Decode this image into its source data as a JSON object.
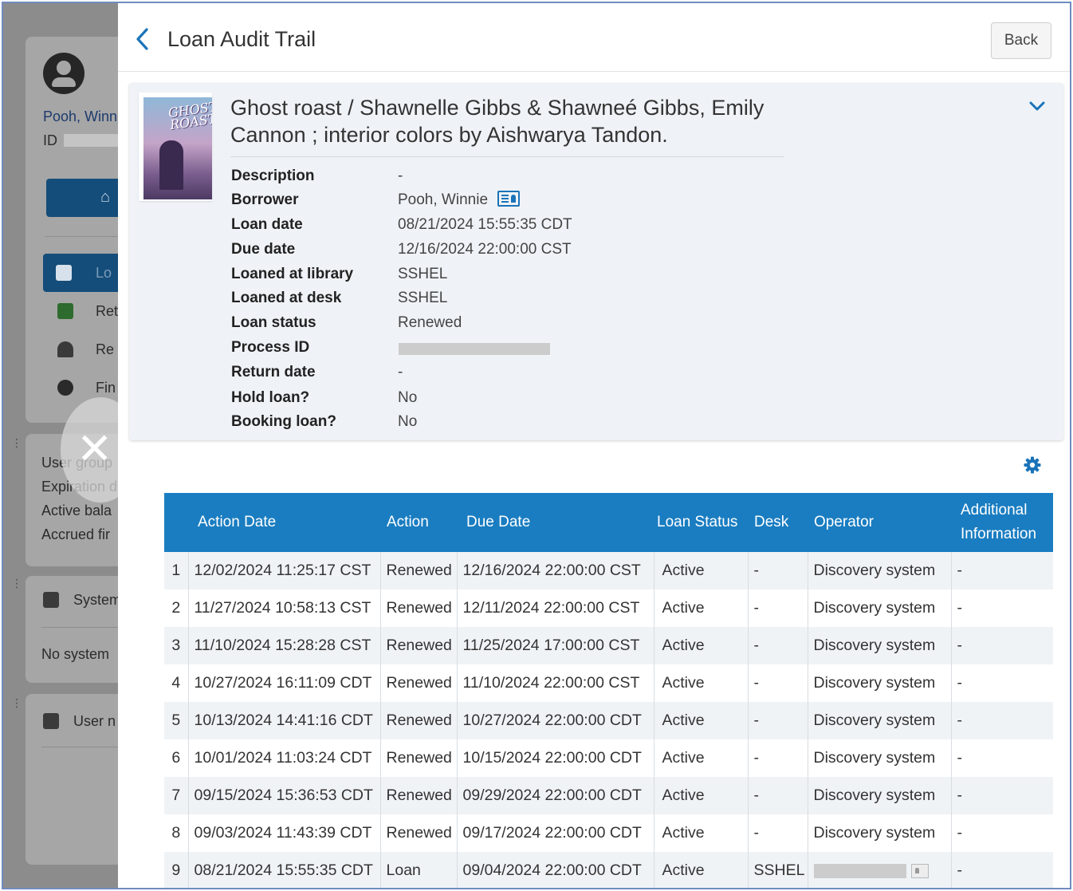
{
  "background": {
    "user_name": "Pooh, Winn",
    "id_label": "ID",
    "nav_items": [
      "Lo",
      "Ret",
      "Re",
      "Fin"
    ],
    "fines_label": "Fin",
    "info_lines": [
      "User group",
      "Expiration d",
      "Active bala",
      "Accrued fir"
    ],
    "system_section": "System",
    "system_empty": "No system",
    "user_notes_section": "User n"
  },
  "header": {
    "title": "Loan Audit Trail",
    "back_label": "Back"
  },
  "item": {
    "title": "Ghost roast / Shawnelle Gibbs & Shawneé Gibbs, Emily Cannon ; interior colors by Aishwarya Tandon.",
    "cover_text": "GHOST\nROAST",
    "fields": [
      {
        "label": "Description",
        "value": "-"
      },
      {
        "label": "Borrower",
        "value": "Pooh, Winnie"
      },
      {
        "label": "Loan date",
        "value": "08/21/2024 15:55:35 CDT"
      },
      {
        "label": "Due date",
        "value": "12/16/2024 22:00:00 CST"
      },
      {
        "label": "Loaned at library",
        "value": "SSHEL"
      },
      {
        "label": "Loaned at desk",
        "value": "SSHEL"
      },
      {
        "label": "Loan status",
        "value": "Renewed"
      },
      {
        "label": "Process ID",
        "value": ""
      },
      {
        "label": "Return date",
        "value": "-"
      },
      {
        "label": "Hold loan?",
        "value": "No"
      },
      {
        "label": "Booking loan?",
        "value": "No"
      }
    ]
  },
  "table": {
    "columns": [
      "",
      "Action Date",
      "Action",
      "Due Date",
      "Loan Status",
      "Desk",
      "Operator",
      "Additional Information"
    ],
    "rows": [
      [
        "1",
        "12/02/2024 11:25:17 CST",
        "Renewed",
        "12/16/2024 22:00:00 CST",
        "Active",
        "-",
        "Discovery system",
        "-"
      ],
      [
        "2",
        "11/27/2024 10:58:13 CST",
        "Renewed",
        "12/11/2024 22:00:00 CST",
        "Active",
        "-",
        "Discovery system",
        "-"
      ],
      [
        "3",
        "11/10/2024 15:28:28 CST",
        "Renewed",
        "11/25/2024 17:00:00 CST",
        "Active",
        "-",
        "Discovery system",
        "-"
      ],
      [
        "4",
        "10/27/2024 16:11:09 CDT",
        "Renewed",
        "11/10/2024 22:00:00 CST",
        "Active",
        "-",
        "Discovery system",
        "-"
      ],
      [
        "5",
        "10/13/2024 14:41:16 CDT",
        "Renewed",
        "10/27/2024 22:00:00 CDT",
        "Active",
        "-",
        "Discovery system",
        "-"
      ],
      [
        "6",
        "10/01/2024 11:03:24 CDT",
        "Renewed",
        "10/15/2024 22:00:00 CDT",
        "Active",
        "-",
        "Discovery system",
        "-"
      ],
      [
        "7",
        "09/15/2024 15:36:53 CDT",
        "Renewed",
        "09/29/2024 22:00:00 CDT",
        "Active",
        "-",
        "Discovery system",
        "-"
      ],
      [
        "8",
        "09/03/2024 11:43:39 CDT",
        "Renewed",
        "09/17/2024 22:00:00 CDT",
        "Active",
        "-",
        "Discovery system",
        "-"
      ],
      [
        "9",
        "08/21/2024 15:55:35 CDT",
        "Loan",
        "09/04/2024 22:00:00 CDT",
        "Active",
        "SSHEL",
        "",
        "-"
      ]
    ]
  },
  "icons": {
    "back": "chevron-left-icon",
    "expand": "chevron-down-icon",
    "settings": "gear-icon",
    "borrower": "contact-card-icon",
    "close": "close-icon"
  },
  "colors": {
    "header_blue": "#1a7dc1",
    "accent": "#1a73b8",
    "card_bg": "#eff3f7"
  }
}
